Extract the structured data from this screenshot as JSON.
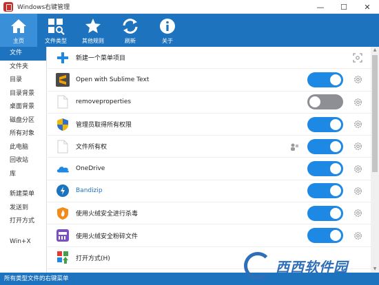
{
  "window": {
    "title": "Windows右键管理",
    "min_glyph": "—",
    "max_glyph": "☐",
    "close_glyph": "✕"
  },
  "toolbar": {
    "items": [
      {
        "label": "主页",
        "icon": "home-icon"
      },
      {
        "label": "文件类型",
        "icon": "file-type-icon"
      },
      {
        "label": "其他规则",
        "icon": "star-icon"
      },
      {
        "label": "刷新",
        "icon": "refresh-icon"
      },
      {
        "label": "关于",
        "icon": "info-icon"
      }
    ]
  },
  "sidebar": {
    "items": [
      "文件",
      "文件夹",
      "目录",
      "目录背景",
      "桌面背景",
      "磁盘分区",
      "所有对象",
      "此电脑",
      "回收站",
      "库"
    ],
    "items2": [
      "新建菜单",
      "发送到",
      "打开方式"
    ],
    "items3": [
      "Win+X"
    ]
  },
  "list": {
    "new_item_label": "新建一个菜单项目",
    "rows": [
      {
        "label": "Open with Sublime Text",
        "icon": "sublime-icon",
        "enabled": true
      },
      {
        "label": "removeproperties",
        "icon": "blank-file-icon",
        "enabled": false
      },
      {
        "label": "管理员取得所有权限",
        "icon": "uac-shield-icon",
        "enabled": true
      },
      {
        "label": "文件所有权",
        "icon": "blank-file-icon",
        "enabled": true
      },
      {
        "label": "OneDrive",
        "icon": "onedrive-icon",
        "enabled": true
      },
      {
        "label": "Bandizip",
        "icon": "bandizip-icon",
        "enabled": true
      },
      {
        "label": "使用火绒安全进行杀毒",
        "icon": "huorong-icon",
        "enabled": true
      },
      {
        "label": "使用火绒安全粉碎文件",
        "icon": "shredder-icon",
        "enabled": true
      },
      {
        "label": "打开方式(H)",
        "icon": "open-with-icon",
        "enabled": true
      }
    ]
  },
  "status": {
    "text": "所有类型文件的右键菜单"
  },
  "watermark": {
    "text": "西西软件园"
  },
  "colors": {
    "accent": "#1e73be",
    "toggle_on": "#1e88e5",
    "toggle_off": "#8e8e95"
  }
}
